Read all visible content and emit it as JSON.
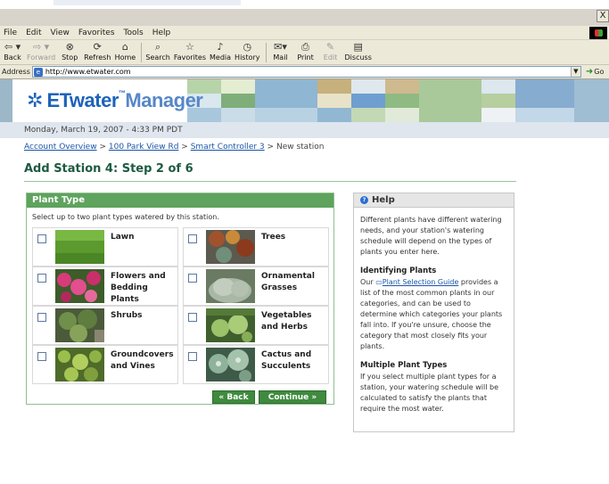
{
  "window": {
    "close_glyph": "X"
  },
  "menu": [
    "File",
    "Edit",
    "View",
    "Favorites",
    "Tools",
    "Help"
  ],
  "toolbar": {
    "back": "Back",
    "forward": "Forward",
    "stop": "Stop",
    "refresh": "Refresh",
    "home": "Home",
    "search": "Search",
    "favorites": "Favorites",
    "media": "Media",
    "history": "History",
    "mail": "Mail",
    "print": "Print",
    "edit": "Edit",
    "discuss": "Discuss"
  },
  "address": {
    "label": "Address",
    "url": "http://www.etwater.com",
    "go": "Go"
  },
  "brand": {
    "name": "ETwater",
    "tm": "™",
    "suffix": "Manager",
    "color": "#1d63b8"
  },
  "date": "Monday, March 19, 2007 - 4:33 PM PDT",
  "breadcrumb": {
    "items": [
      "Account Overview",
      "100 Park View Rd",
      "Smart Controller 3"
    ],
    "separator": ">",
    "current": "New station"
  },
  "page_title": "Add Station 4: Step 2 of 6",
  "plant_panel": {
    "title": "Plant Type",
    "instruction": "Select up to two plant types watered by this station.",
    "plants": [
      {
        "label": "Lawn",
        "checked": false,
        "icon": "lawn-photo"
      },
      {
        "label": "Trees",
        "checked": false,
        "icon": "trees-photo"
      },
      {
        "label": "Flowers and Bedding Plants",
        "checked": false,
        "icon": "flowers-photo"
      },
      {
        "label": "Ornamental Grasses",
        "checked": false,
        "icon": "grasses-photo"
      },
      {
        "label": "Shrubs",
        "checked": false,
        "icon": "shrubs-photo"
      },
      {
        "label": "Vegetables and Herbs",
        "checked": false,
        "icon": "vegetables-photo"
      },
      {
        "label": "Groundcovers and Vines",
        "checked": false,
        "icon": "groundcovers-photo"
      },
      {
        "label": "Cactus and Succulents",
        "checked": false,
        "icon": "cactus-photo"
      }
    ],
    "back_button": "« Back",
    "continue_button": "Continue »"
  },
  "help": {
    "title": "Help",
    "intro": "Different plants have different watering needs, and your station's watering schedule will depend on the types of plants you enter here.",
    "section1_title": "Identifying Plants",
    "section1_pre": "Our ",
    "section1_link": "Plant Selection Guide",
    "section1_post": " provides a list of the most common plants in our categories, and can be used to determine which categories your plants fall into. If you're unsure, choose the category that most closely fits your plants.",
    "section2_title": "Multiple Plant Types",
    "section2_body": "If you select multiple plant types for a station, your watering schedule will be calculated to satisfy the plants that require the most water."
  },
  "colors": {
    "accent_green": "#5ea35e",
    "button_green": "#3f8a3f",
    "title_green": "#1d5a42",
    "link_blue": "#1a55a8",
    "date_bar": "#dfe6ee"
  }
}
